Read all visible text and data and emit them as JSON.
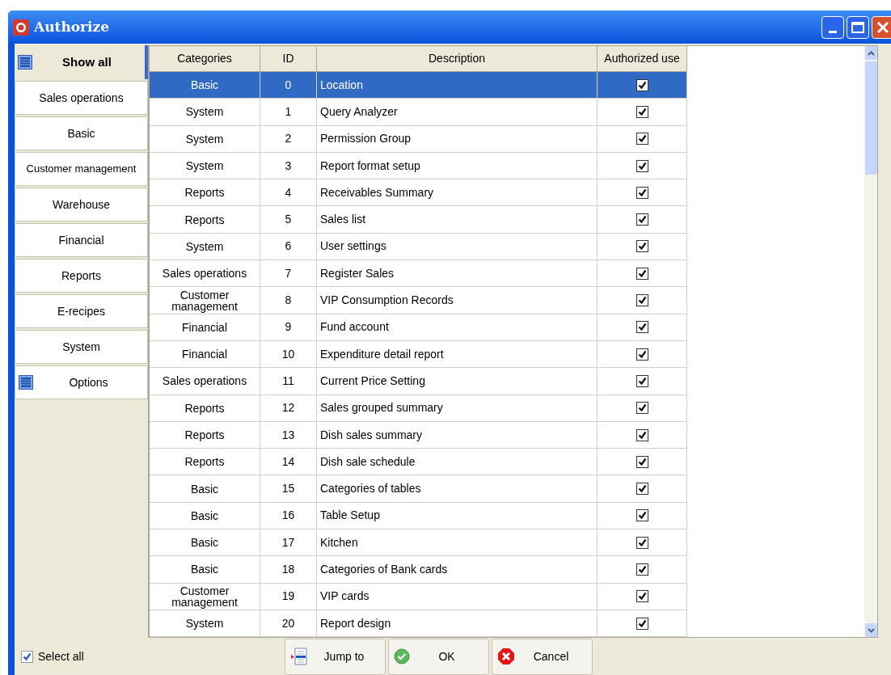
{
  "window": {
    "title": "Authorize"
  },
  "sidebar": {
    "tabs": [
      {
        "label": "Show all",
        "selected": true,
        "icon": true
      },
      {
        "label": "Sales operations",
        "selected": false,
        "icon": false
      },
      {
        "label": "Basic",
        "selected": false,
        "icon": false
      },
      {
        "label": "Customer management",
        "selected": false,
        "icon": false
      },
      {
        "label": "Warehouse",
        "selected": false,
        "icon": false
      },
      {
        "label": "Financial",
        "selected": false,
        "icon": false
      },
      {
        "label": "Reports",
        "selected": false,
        "icon": false
      },
      {
        "label": "E-recipes",
        "selected": false,
        "icon": false
      },
      {
        "label": "System",
        "selected": false,
        "icon": false
      },
      {
        "label": "Options",
        "selected": false,
        "icon": true
      }
    ]
  },
  "table": {
    "columns": [
      "Categories",
      "ID",
      "Description",
      "Authorized use"
    ],
    "rows": [
      {
        "category": "Basic",
        "id": "0",
        "description": "Location",
        "authorized": true,
        "selected": true
      },
      {
        "category": "System",
        "id": "1",
        "description": "Query Analyzer",
        "authorized": true,
        "selected": false
      },
      {
        "category": "System",
        "id": "2",
        "description": "Permission Group",
        "authorized": true,
        "selected": false
      },
      {
        "category": "System",
        "id": "3",
        "description": "Report format setup",
        "authorized": true,
        "selected": false
      },
      {
        "category": "Reports",
        "id": "4",
        "description": "Receivables Summary",
        "authorized": true,
        "selected": false
      },
      {
        "category": "Reports",
        "id": "5",
        "description": "Sales list",
        "authorized": true,
        "selected": false
      },
      {
        "category": "System",
        "id": "6",
        "description": "User settings",
        "authorized": true,
        "selected": false
      },
      {
        "category": "Sales operations",
        "id": "7",
        "description": "Register Sales",
        "authorized": true,
        "selected": false
      },
      {
        "category": "Customer management",
        "id": "8",
        "description": "VIP Consumption Records",
        "authorized": true,
        "selected": false
      },
      {
        "category": "Financial",
        "id": "9",
        "description": "Fund account",
        "authorized": true,
        "selected": false
      },
      {
        "category": "Financial",
        "id": "10",
        "description": "Expenditure detail report",
        "authorized": true,
        "selected": false
      },
      {
        "category": "Sales operations",
        "id": "11",
        "description": "Current Price Setting",
        "authorized": true,
        "selected": false
      },
      {
        "category": "Reports",
        "id": "12",
        "description": "Sales grouped summary",
        "authorized": true,
        "selected": false
      },
      {
        "category": "Reports",
        "id": "13",
        "description": "Dish sales summary",
        "authorized": true,
        "selected": false
      },
      {
        "category": "Reports",
        "id": "14",
        "description": "Dish sale schedule",
        "authorized": true,
        "selected": false
      },
      {
        "category": "Basic",
        "id": "15",
        "description": "Categories of tables",
        "authorized": true,
        "selected": false
      },
      {
        "category": "Basic",
        "id": "16",
        "description": "Table Setup",
        "authorized": true,
        "selected": false
      },
      {
        "category": "Basic",
        "id": "17",
        "description": "Kitchen",
        "authorized": true,
        "selected": false
      },
      {
        "category": "Basic",
        "id": "18",
        "description": "Categories of Bank cards",
        "authorized": true,
        "selected": false
      },
      {
        "category": "Customer management",
        "id": "19",
        "description": "VIP cards",
        "authorized": true,
        "selected": false
      },
      {
        "category": "System",
        "id": "20",
        "description": "Report design",
        "authorized": true,
        "selected": false
      }
    ]
  },
  "select_all": {
    "label": "Select all",
    "checked": true
  },
  "buttons": [
    {
      "kind": "jump",
      "label": "Jump to"
    },
    {
      "kind": "ok",
      "label": "OK"
    },
    {
      "kind": "cancel",
      "label": "Cancel"
    }
  ]
}
